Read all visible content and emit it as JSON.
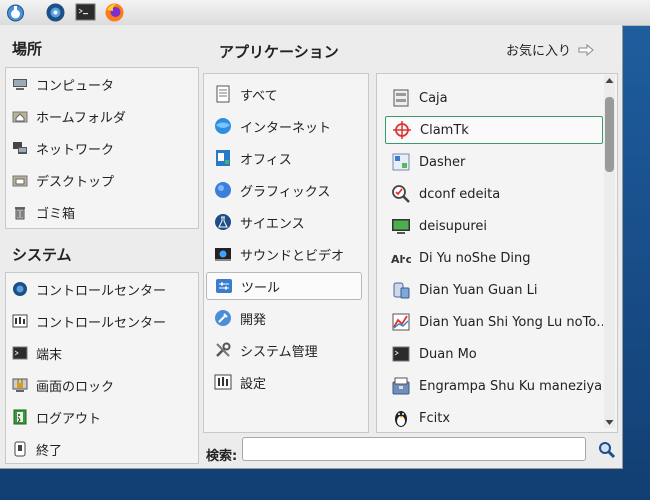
{
  "places": {
    "title": "場所",
    "items": [
      {
        "label": "コンピュータ",
        "icon": "computer-icon"
      },
      {
        "label": "ホームフォルダ",
        "icon": "home-folder-icon"
      },
      {
        "label": "ネットワーク",
        "icon": "network-icon"
      },
      {
        "label": "デスクトップ",
        "icon": "desktop-folder-icon"
      },
      {
        "label": "ゴミ箱",
        "icon": "trash-icon"
      }
    ]
  },
  "system": {
    "title": "システム",
    "items": [
      {
        "label": "コントロールセンター",
        "icon": "control-center-icon"
      },
      {
        "label": "コントロールセンター",
        "icon": "control-center-alt-icon"
      },
      {
        "label": "端末",
        "icon": "terminal-icon"
      },
      {
        "label": "画面のロック",
        "icon": "lock-screen-icon"
      },
      {
        "label": "ログアウト",
        "icon": "logout-icon"
      },
      {
        "label": "終了",
        "icon": "shutdown-icon"
      }
    ]
  },
  "applications": {
    "title": "アプリケーション",
    "favorites_label": "お気に入り",
    "categories": [
      {
        "label": "すべて",
        "icon": "all-apps-icon"
      },
      {
        "label": "インターネット",
        "icon": "internet-icon"
      },
      {
        "label": "オフィス",
        "icon": "office-icon"
      },
      {
        "label": "グラフィックス",
        "icon": "graphics-icon"
      },
      {
        "label": "サイエンス",
        "icon": "science-icon"
      },
      {
        "label": "サウンドとビデオ",
        "icon": "sound-video-icon"
      },
      {
        "label": "ツール",
        "icon": "tools-icon",
        "selected": true
      },
      {
        "label": "開発",
        "icon": "development-icon"
      },
      {
        "label": "システム管理",
        "icon": "system-admin-icon"
      },
      {
        "label": "設定",
        "icon": "settings-icon"
      }
    ],
    "apps": [
      {
        "label": "Caja",
        "icon": "file-manager-icon"
      },
      {
        "label": "ClamTk",
        "icon": "antivirus-target-icon",
        "selected": true
      },
      {
        "label": "Dasher",
        "icon": "dasher-icon"
      },
      {
        "label": "dconf edeita",
        "icon": "dconf-editor-icon"
      },
      {
        "label": "deisupurei",
        "icon": "display-icon"
      },
      {
        "label": "Di Yu noShe Ding",
        "icon": "region-settings-icon"
      },
      {
        "label": "Dian Yuan Guan Li",
        "icon": "power-manager-icon"
      },
      {
        "label": "Dian Yuan Shi Yong Lu noTo…",
        "icon": "power-statistics-icon"
      },
      {
        "label": "Duan Mo",
        "icon": "terminal-app-icon"
      },
      {
        "label": "Engrampa Shu Ku maneziya",
        "icon": "archive-manager-icon"
      },
      {
        "label": "Fcitx",
        "icon": "penguin-icon"
      }
    ]
  },
  "search": {
    "label": "検索:",
    "value": "",
    "placeholder": ""
  },
  "colors": {
    "accent_border": "#3c9a6a",
    "desktop_blue": "#1f5fa0"
  }
}
